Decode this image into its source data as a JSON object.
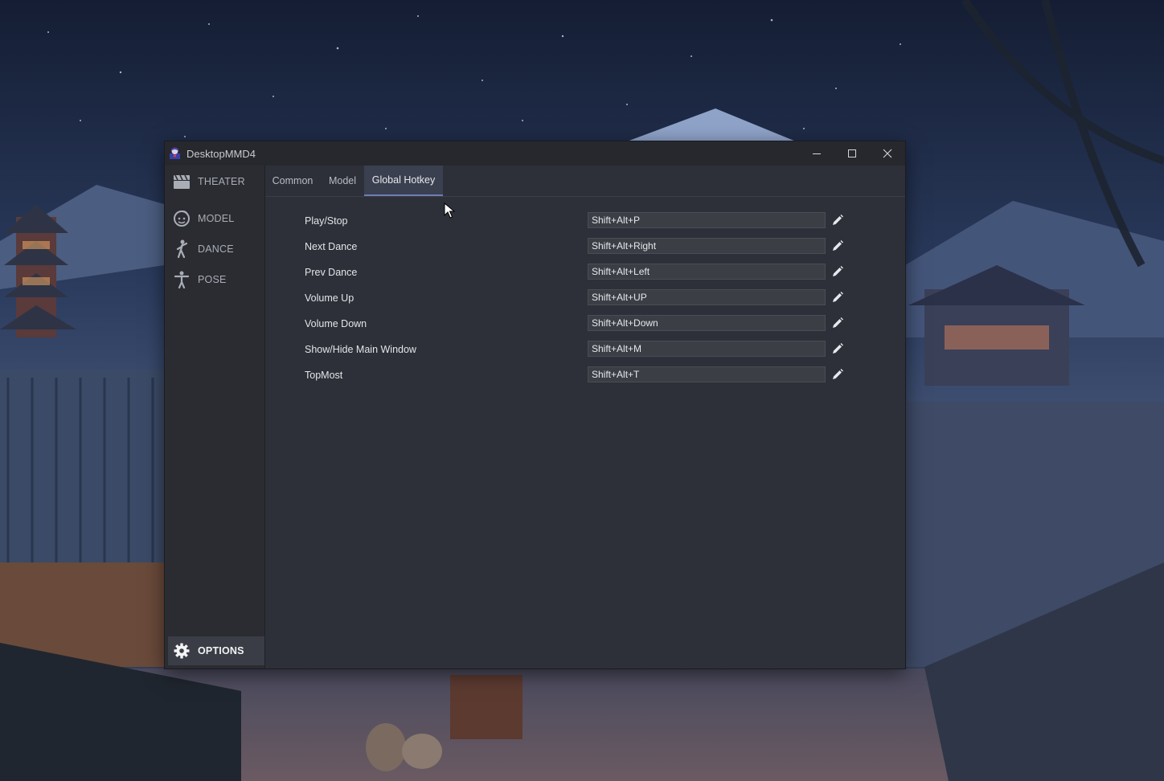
{
  "window": {
    "title": "DesktopMMD4",
    "controls": [
      "minimize",
      "maximize",
      "close"
    ]
  },
  "sidebar": {
    "items": [
      {
        "label": "THEATER",
        "icon": "theater-icon"
      },
      {
        "label": "MODEL",
        "icon": "face-icon"
      },
      {
        "label": "DANCE",
        "icon": "dancer-icon"
      },
      {
        "label": "POSE",
        "icon": "pose-icon"
      },
      {
        "label": "OPTIONS",
        "icon": "gear-icon",
        "active": true
      }
    ]
  },
  "tabs": [
    {
      "label": "Common"
    },
    {
      "label": "Model"
    },
    {
      "label": "Global Hotkey",
      "active": true
    }
  ],
  "hotkeys": [
    {
      "label": "Play/Stop",
      "value": "Shift+Alt+P"
    },
    {
      "label": "Next Dance",
      "value": "Shift+Alt+Right"
    },
    {
      "label": "Prev Dance",
      "value": "Shift+Alt+Left"
    },
    {
      "label": "Volume Up",
      "value": "Shift+Alt+UP"
    },
    {
      "label": "Volume Down",
      "value": "Shift+Alt+Down"
    },
    {
      "label": "Show/Hide Main Window",
      "value": "Shift+Alt+M"
    },
    {
      "label": "TopMost",
      "value": "Shift+Alt+T"
    }
  ],
  "colors": {
    "window_bg": "#2d3038",
    "titlebar_bg": "#26282d",
    "active_tab": "#3b4050",
    "accent": "#6d7db3"
  }
}
